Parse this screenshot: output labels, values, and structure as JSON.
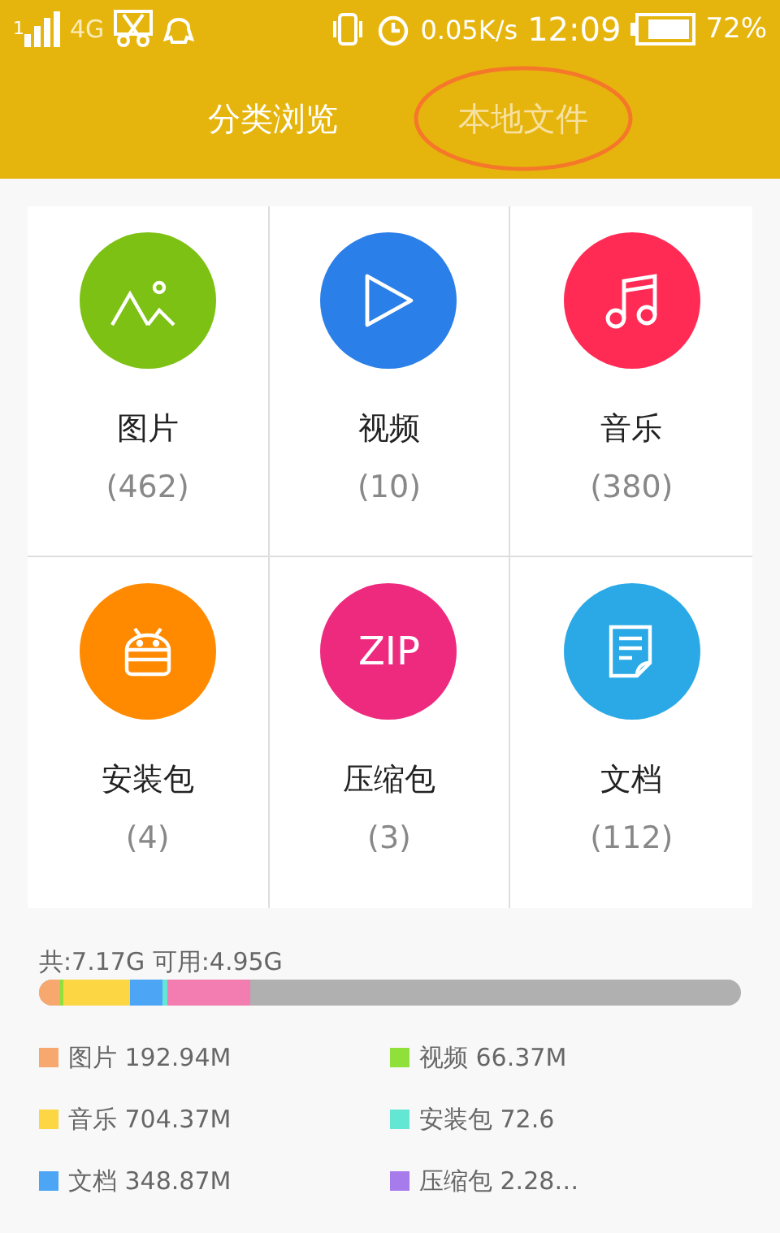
{
  "status_bar": {
    "signal_label": "1",
    "network": "4G",
    "speed": "0.05K/s",
    "time": "12:09",
    "battery": "72%"
  },
  "tabs": [
    {
      "label": "分类浏览",
      "selected": true,
      "circled": false
    },
    {
      "label": "本地文件",
      "selected": false,
      "circled": true
    }
  ],
  "categories": [
    {
      "kind": "image",
      "name": "图片",
      "count": "(462)",
      "color": "#7dc114"
    },
    {
      "kind": "video",
      "name": "视频",
      "count": "(10)",
      "color": "#2b7fe8"
    },
    {
      "kind": "music",
      "name": "音乐",
      "count": "(380)",
      "color": "#ff2b55"
    },
    {
      "kind": "apk",
      "name": "安装包",
      "count": "(4)",
      "color": "#ff8a00"
    },
    {
      "kind": "zip",
      "name": "压缩包",
      "count": "(3)",
      "color": "#ee2a7f",
      "icon_text": "ZIP"
    },
    {
      "kind": "doc",
      "name": "文档",
      "count": "(112)",
      "color": "#2aa9e6"
    }
  ],
  "storage": {
    "summary": "共:7.17G 可用:4.95G",
    "segments": [
      {
        "color": "#f7a86f"
      },
      {
        "color": "#8fe03a"
      },
      {
        "color": "#fcd643"
      },
      {
        "color": "#4da6f5"
      },
      {
        "color": "#64e6d4"
      },
      {
        "color": "#f37db1"
      }
    ],
    "legend": [
      {
        "label": "图片 192.94M",
        "color": "#f7a86f"
      },
      {
        "label": "视频 66.37M",
        "color": "#8fe03a"
      },
      {
        "label": "音乐 704.37M",
        "color": "#fcd643"
      },
      {
        "label": "安装包 72.6",
        "color": "#64e6d4"
      },
      {
        "label": "文档 348.87M",
        "color": "#4da6f5"
      },
      {
        "label": "压缩包 2.28…",
        "color": "#a87bec"
      }
    ]
  }
}
